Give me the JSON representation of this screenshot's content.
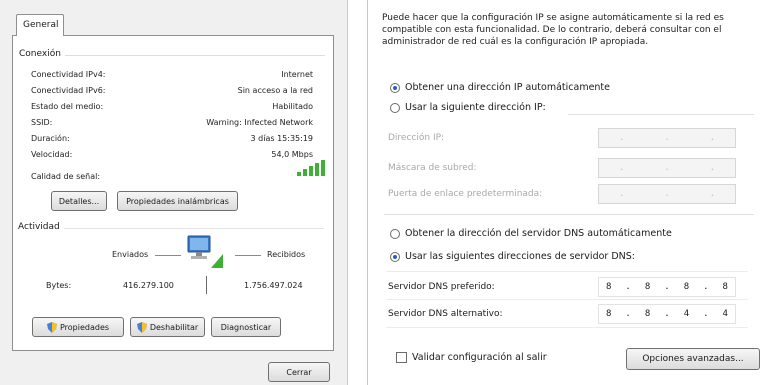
{
  "left": {
    "tab_general": "General",
    "connection_group": "Conexión",
    "rows": [
      {
        "label": "Conectividad IPv4:",
        "value": "Internet"
      },
      {
        "label": "Conectividad IPv6:",
        "value": "Sin acceso a la red"
      },
      {
        "label": "Estado del medio:",
        "value": "Habilitado"
      },
      {
        "label": "SSID:",
        "value": "Warning: Infected Network"
      },
      {
        "label": "Duración:",
        "value": "3 días 15:35:19"
      },
      {
        "label": "Velocidad:",
        "value": "54,0 Mbps"
      }
    ],
    "signal_label": "Calidad de señal:",
    "details_button": "Detalles...",
    "wireless_props_button": "Propiedades inalámbricas",
    "activity_group": "Actividad",
    "sent_label": "Enviados",
    "received_label": "Recibidos",
    "bytes_label": "Bytes:",
    "bytes_sent": "416.279.100",
    "bytes_received": "1.756.497.024",
    "properties_button": "Propiedades",
    "disable_button": "Deshabilitar",
    "diagnose_button": "Diagnosticar",
    "close_button": "Cerrar"
  },
  "right": {
    "description": "Puede hacer que la configuración IP se asigne automáticamente si la red es compatible con esta funcionalidad. De lo contrario, deberá consultar con el administrador de red cuál es la configuración IP apropiada.",
    "radio_auto_ip": "Obtener una dirección IP automáticamente",
    "radio_manual_ip": "Usar la siguiente dirección IP:",
    "ip_address_label": "Dirección IP:",
    "subnet_label": "Máscara de subred:",
    "gateway_label": "Puerta de enlace predeterminada:",
    "radio_auto_dns": "Obtener la dirección del servidor DNS automáticamente",
    "radio_manual_dns": "Usar las siguientes direcciones de servidor DNS:",
    "preferred_dns_label": "Servidor DNS preferido:",
    "preferred_dns": [
      "8",
      "8",
      "8",
      "8"
    ],
    "alternate_dns_label": "Servidor DNS alternativo:",
    "alternate_dns": [
      "8",
      "8",
      "4",
      "4"
    ],
    "validate_label": "Validar configuración al salir",
    "advanced_button": "Opciones avanzadas..."
  },
  "colors": {
    "signal_green": "#3db035",
    "radio_selected": "#2a5fb8",
    "disabled_text": "#a8a8a8"
  }
}
